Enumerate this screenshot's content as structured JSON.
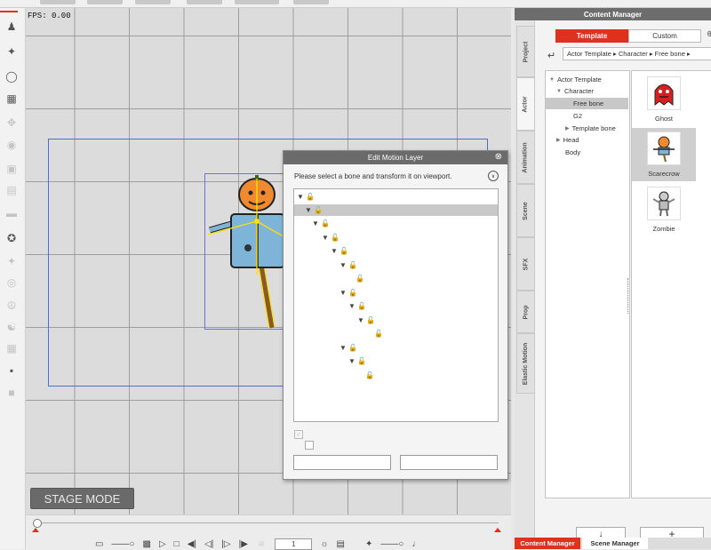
{
  "viewport": {
    "fps_label": "FPS: 0.00",
    "stage_mode_label": "STAGE MODE"
  },
  "timeline": {
    "frame_value": "1"
  },
  "content_manager": {
    "title": "Content Manager",
    "vertical_tabs": [
      "Project",
      "Actor",
      "Animation",
      "Scene",
      "SFX",
      "Prop",
      "Elastic Motion"
    ],
    "active_vertical_tab": "Actor",
    "tabs": {
      "template": "Template",
      "custom": "Custom"
    },
    "breadcrumb": "Actor Template ▸ Character ▸ Free bone ▸",
    "tree": [
      {
        "label": "Actor Template",
        "arrow": "▼"
      },
      {
        "label": "Character",
        "arrow": "▼"
      },
      {
        "label": "Free bone",
        "arrow": ""
      },
      {
        "label": "G2",
        "arrow": ""
      },
      {
        "label": "Template bone",
        "arrow": "▶"
      },
      {
        "label": "Head",
        "arrow": "▶"
      },
      {
        "label": "Body",
        "arrow": ""
      }
    ],
    "thumbnails": [
      {
        "label": "Ghost",
        "icon": "ghost-icon"
      },
      {
        "label": "Scarecrow",
        "icon": "scarecrow-icon"
      },
      {
        "label": "Zombie",
        "icon": "zombie-icon"
      }
    ],
    "down_button": "↓",
    "add_button": "+",
    "bottom_tabs": {
      "content_manager": "Content Manager",
      "scene_manager": "Scene Manager"
    }
  },
  "dialog": {
    "title": "Edit Motion Layer",
    "instruction": "Please select a bone and transform it on viewport.",
    "close_glyph": "⊗",
    "help_glyph": "∨",
    "bone_glyph": "▼ 🔓",
    "bone_leaf_glyph": "🔓"
  },
  "colors": {
    "accent": "#e0301e",
    "title_bar": "#6b6b6b"
  }
}
